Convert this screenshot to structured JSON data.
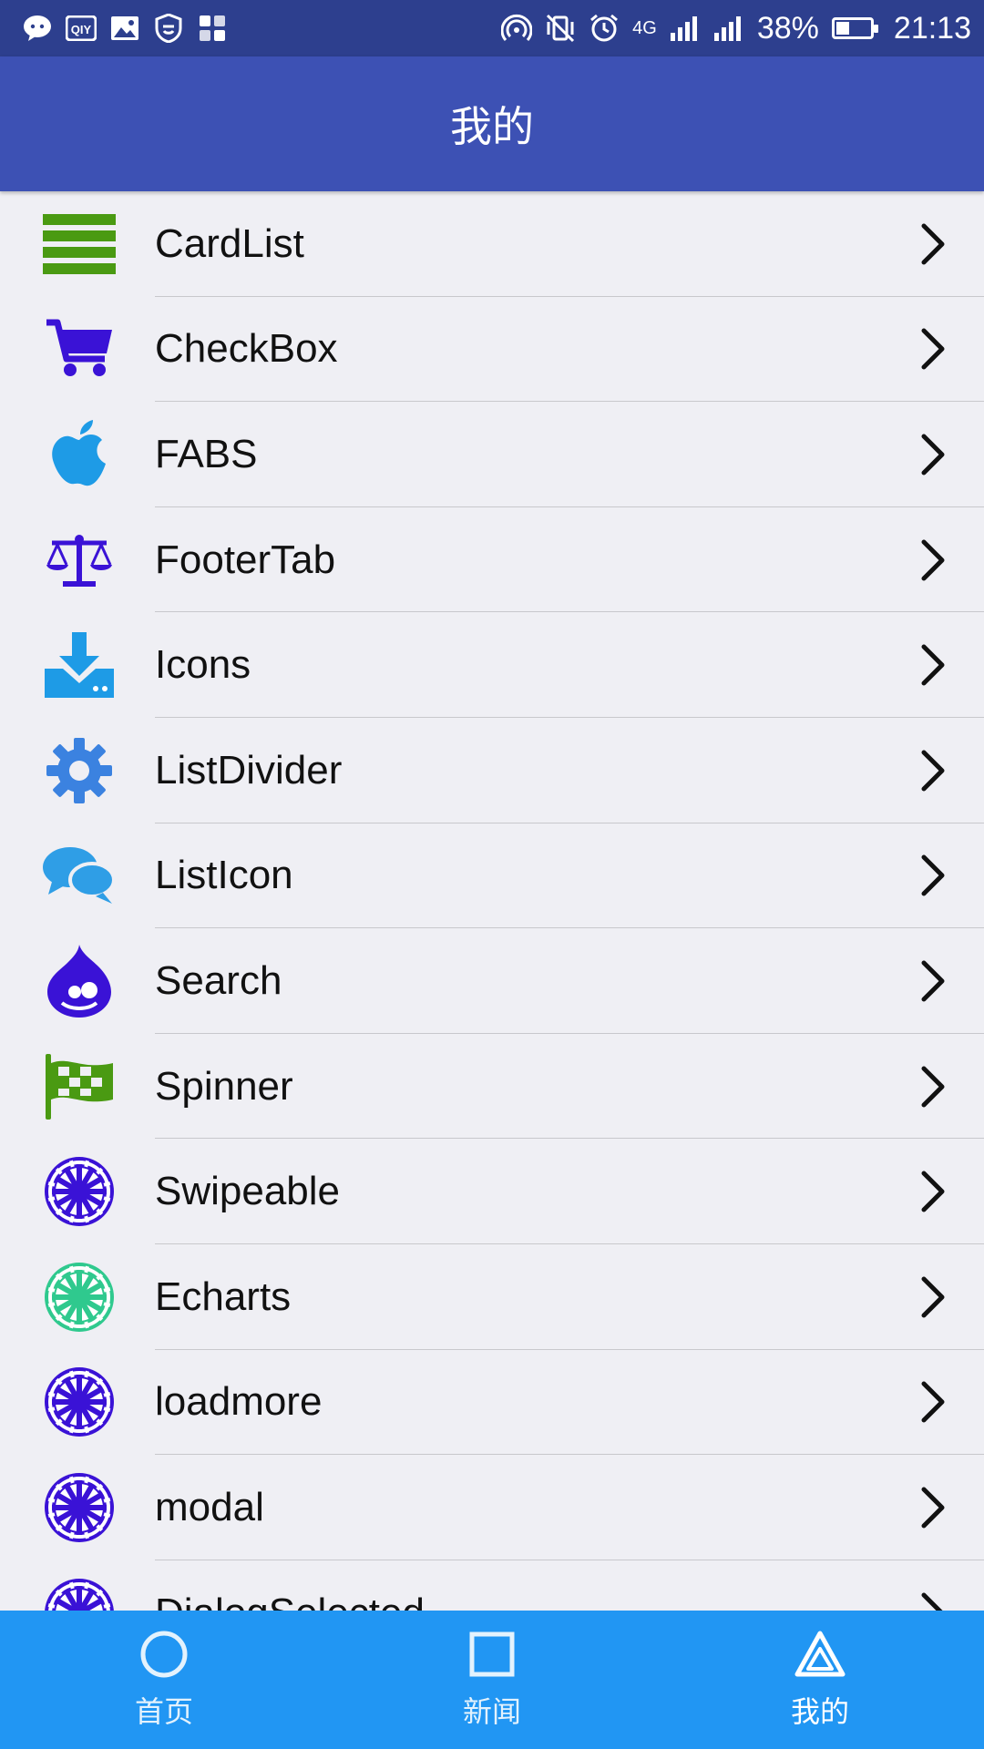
{
  "status_bar": {
    "network": "4G",
    "battery": "38%",
    "battery_level": 0.38,
    "time": "21:13",
    "left_icons": [
      "wechat-icon",
      "iqiyi-icon",
      "image-icon",
      "shield-icon",
      "apps-icon"
    ],
    "right_icons": [
      "hotspot-icon",
      "vibrate-off-icon",
      "alarm-icon",
      "signal-icon",
      "signal-icon"
    ]
  },
  "header": {
    "title": "我的"
  },
  "list": {
    "items": [
      {
        "label": "CardList",
        "icon": "list-icon",
        "color": "#4a9a12"
      },
      {
        "label": "CheckBox",
        "icon": "cart-icon",
        "color": "#3a12d6"
      },
      {
        "label": "FABS",
        "icon": "apple-icon",
        "color": "#1e9be6"
      },
      {
        "label": "FooterTab",
        "icon": "balance-scale-icon",
        "color": "#3a12d6"
      },
      {
        "label": "Icons",
        "icon": "download-icon",
        "color": "#1e9be6"
      },
      {
        "label": "ListDivider",
        "icon": "gear-icon",
        "color": "#3b82e0"
      },
      {
        "label": "ListIcon",
        "icon": "chat-bubbles-icon",
        "color": "#2f9ee6"
      },
      {
        "label": "Search",
        "icon": "drupal-icon",
        "color": "#3a12d6"
      },
      {
        "label": "Spinner",
        "icon": "flag-icon",
        "color": "#4a9a12"
      },
      {
        "label": "Swipeable",
        "icon": "empire-icon",
        "color": "#3a12d6"
      },
      {
        "label": "Echarts",
        "icon": "empire-icon",
        "color": "#2fc98e"
      },
      {
        "label": "loadmore",
        "icon": "empire-icon",
        "color": "#3a12d6"
      },
      {
        "label": "modal",
        "icon": "empire-icon",
        "color": "#3a12d6"
      },
      {
        "label": "DialogSelected",
        "icon": "empire-icon",
        "color": "#3a12d6"
      }
    ]
  },
  "tabbar": {
    "tabs": [
      {
        "label": "首页",
        "icon": "circle-icon"
      },
      {
        "label": "新闻",
        "icon": "square-icon"
      },
      {
        "label": "我的",
        "icon": "triangle-icon",
        "active": true
      }
    ]
  }
}
